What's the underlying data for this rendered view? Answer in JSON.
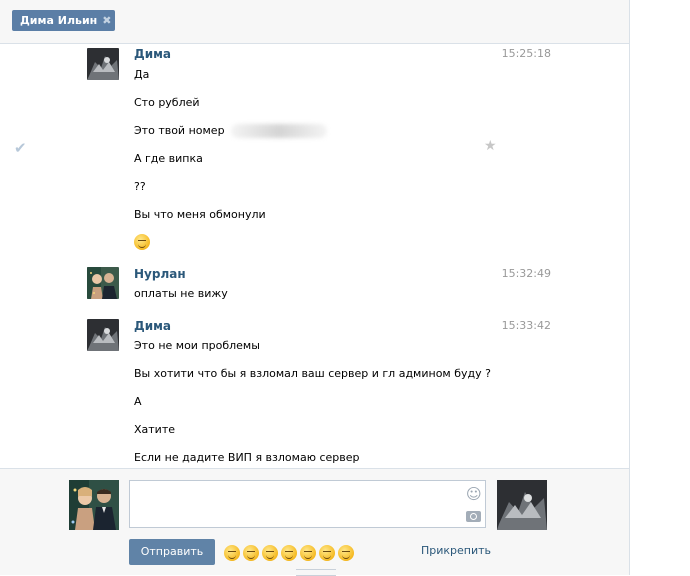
{
  "header": {
    "recipient_chip": "Дима Ильин",
    "chip_close_icon": "close-icon"
  },
  "messages": [
    {
      "author": "Дима",
      "time": "15:25:18",
      "lines": [
        "Да",
        "Сто рублей",
        "Это твой номер",
        "А где випка",
        "??",
        "Вы что меня обмонули"
      ]
    },
    {
      "author": "Нурлан",
      "time": "15:32:49",
      "lines": [
        "оплаты не вижу"
      ]
    },
    {
      "author": "Дима",
      "time": "15:33:42",
      "lines": [
        "Это не мои проблемы",
        "Вы хотити что бы я взломал ваш сервер и гл админом буду ?",
        "А",
        "Хатите",
        "Если не дадите ВИП я взломаю сервер"
      ]
    }
  ],
  "composer": {
    "send_label": "Отправить",
    "attach_label": "Прикрепить",
    "input_value": "",
    "emoji_icons": [
      "laughing-emoji-icon",
      "grin-emoji-icon",
      "wink-emoji-icon",
      "thumbs-up-emoji-icon",
      "sunglasses-emoji-icon",
      "tears-of-joy-emoji-icon",
      "smile-emoji-icon"
    ]
  },
  "colors": {
    "accent": "#5b7ea6",
    "author": "#2b587a",
    "send_button": "#6083a7"
  }
}
